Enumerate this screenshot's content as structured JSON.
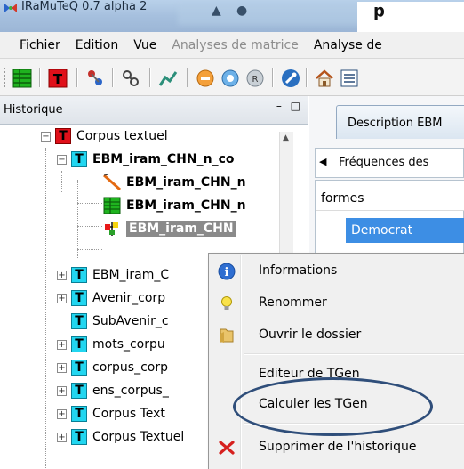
{
  "window": {
    "title": "IRaMuTeQ 0.7 alpha 2",
    "overlay_fragment": "p"
  },
  "menubar": {
    "items": [
      {
        "label": "Fichier",
        "disabled": false
      },
      {
        "label": "Edition",
        "disabled": false
      },
      {
        "label": "Vue",
        "disabled": false
      },
      {
        "label": "Analyses de matrice",
        "disabled": true
      },
      {
        "label": "Analyse de",
        "disabled": false
      }
    ]
  },
  "left_pane": {
    "title": "Historique",
    "header_buttons": "– □",
    "tree": [
      {
        "label": "Corpus textuel",
        "bold": false
      },
      {
        "label": "EBM_iram_CHN_n_co",
        "bold": true
      },
      {
        "label": "EBM_iram_CHN_n",
        "bold": true
      },
      {
        "label": "EBM_iram_CHN_n",
        "bold": true
      },
      {
        "label": "EBM_iram_CHN",
        "bold": true
      },
      {
        "label": "EBM_iram_C",
        "bold": false
      },
      {
        "label": "Avenir_corp",
        "bold": false
      },
      {
        "label": "SubAvenir_c",
        "bold": false
      },
      {
        "label": "mots_corpu",
        "bold": false
      },
      {
        "label": "corpus_corp",
        "bold": false
      },
      {
        "label": "ens_corpus_",
        "bold": false
      },
      {
        "label": "Corpus Text",
        "bold": false
      },
      {
        "label": "Corpus Textuel",
        "bold": false
      }
    ]
  },
  "right_pane": {
    "tab_label": "Description EBM",
    "subtab_label": "Fréquences des",
    "list_header": "formes",
    "selected_item": "Democrat"
  },
  "context_menu": {
    "items": [
      {
        "label": "Informations",
        "icon": "info-icon"
      },
      {
        "label": "Renommer",
        "icon": "lightbulb-icon"
      },
      {
        "label": "Ouvrir le dossier",
        "icon": "folder-icon"
      },
      {
        "label": "Editeur de TGen",
        "icon": ""
      },
      {
        "label": "Calculer les TGen",
        "icon": ""
      },
      {
        "label": "Supprimer de l'historique",
        "icon": "delete-icon"
      }
    ]
  },
  "colors": {
    "accent": "#3d8ee4",
    "annotation": "#2f4e7a",
    "tree_red": "#e0101a",
    "tree_cyan": "#22d6f0"
  }
}
